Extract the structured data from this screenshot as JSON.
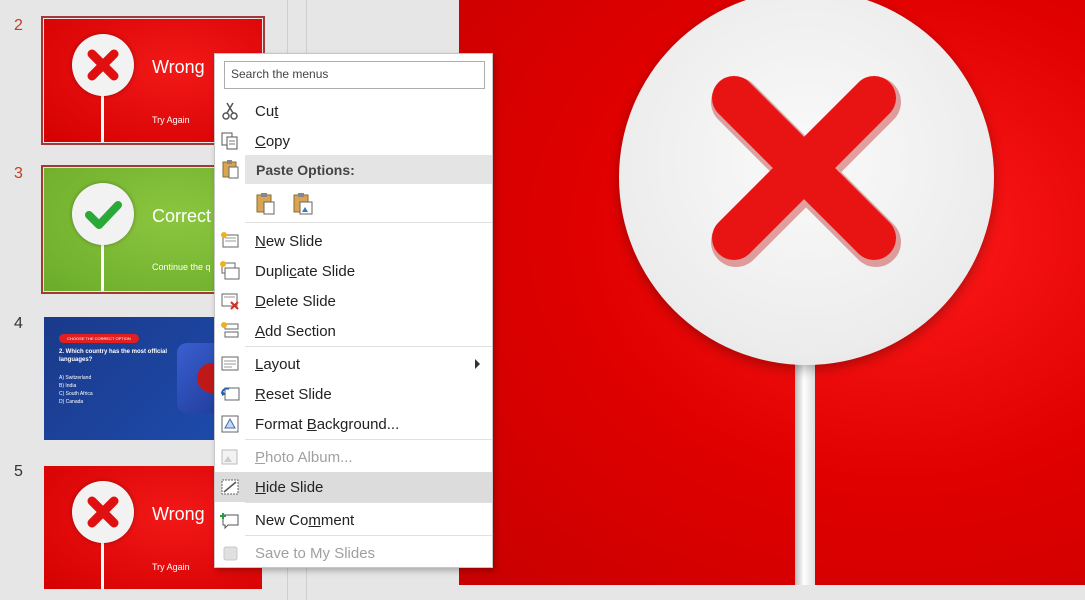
{
  "thumbnails": [
    {
      "number": "2",
      "title": "Wrong",
      "subtitle": "Try Again",
      "selected": true
    },
    {
      "number": "3",
      "title": "Correct",
      "subtitle": "Continue the q",
      "selected": true
    },
    {
      "number": "4",
      "pill": "CHOOSE THE CORRECT OPTION",
      "question": "2. Which country has the most official languages?",
      "options": [
        "A) Switzerland",
        "B) India",
        "C) South Africa",
        "D) Canada"
      ]
    },
    {
      "number": "5",
      "title": "Wrong",
      "subtitle": "Try Again"
    }
  ],
  "context_menu": {
    "search_placeholder": "Search the menus",
    "cut": {
      "pre": "Cu",
      "u": "t",
      "post": ""
    },
    "copy": {
      "pre": "",
      "u": "C",
      "post": "opy"
    },
    "paste_options": "Paste Options:",
    "new_slide": {
      "pre": "",
      "u": "N",
      "post": "ew Slide"
    },
    "duplicate_slide": {
      "pre": "Dupli",
      "u": "c",
      "post": "ate Slide"
    },
    "delete_slide": {
      "pre": "",
      "u": "D",
      "post": "elete Slide"
    },
    "add_section": {
      "pre": "",
      "u": "A",
      "post": "dd Section"
    },
    "layout": {
      "pre": "",
      "u": "L",
      "post": "ayout"
    },
    "reset_slide": {
      "pre": "",
      "u": "R",
      "post": "eset Slide"
    },
    "format_background": {
      "pre": "Format ",
      "u": "B",
      "post": "ackground..."
    },
    "photo_album": {
      "pre": "",
      "u": "P",
      "post": "hoto Album..."
    },
    "hide_slide": {
      "pre": "",
      "u": "H",
      "post": "ide Slide"
    },
    "new_comment": {
      "pre": "New Co",
      "u": "m",
      "post": "ment"
    },
    "save_to_my_slides": "Save to My Slides"
  },
  "colors": {
    "accent_red": "#e00000",
    "selection_border": "#a4373a",
    "green": "#8cc63f"
  }
}
